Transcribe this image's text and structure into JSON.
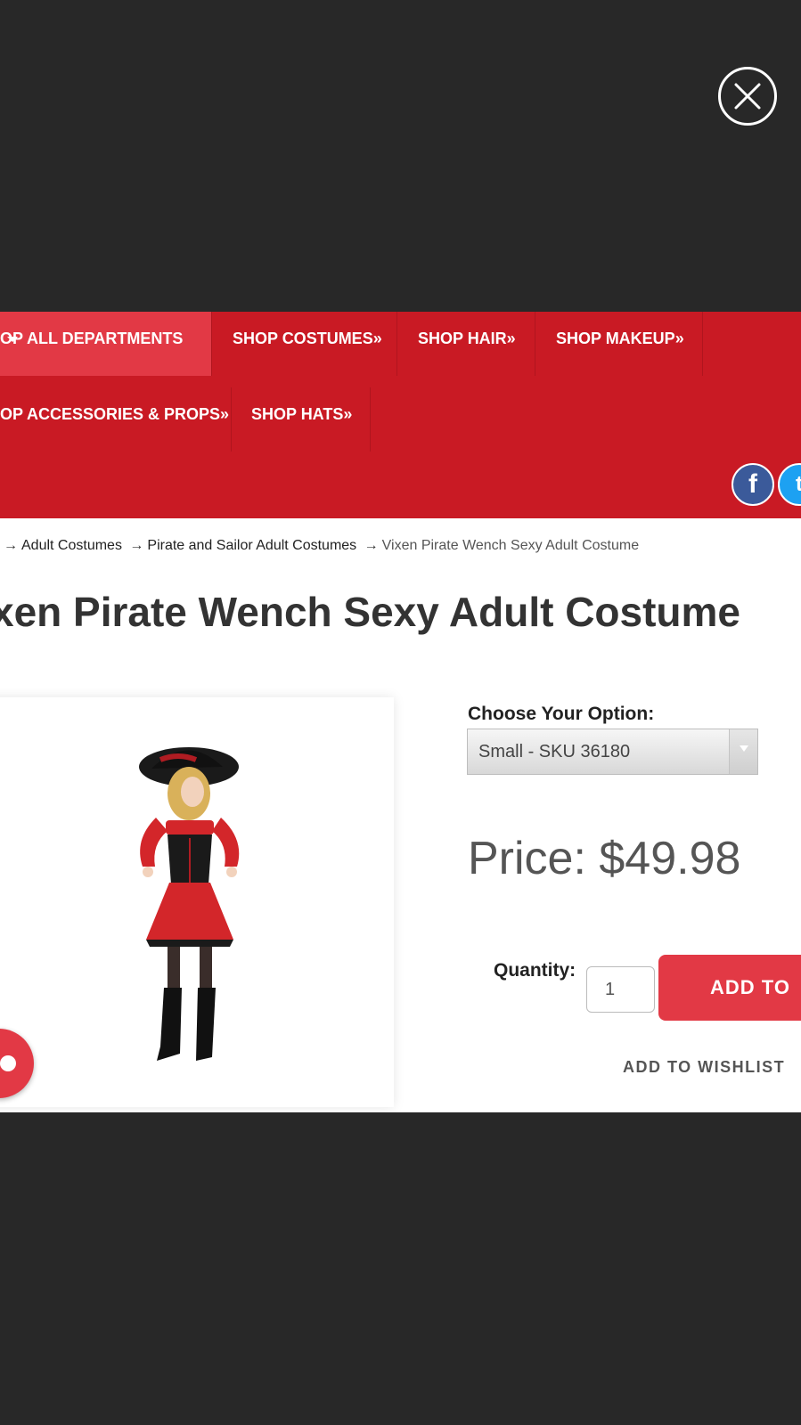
{
  "overlay": {
    "close_icon": "close-icon"
  },
  "nav": {
    "row1": [
      {
        "label": "OP ALL DEPARTMENTS",
        "active": true,
        "icon": "caret-down-icon"
      },
      {
        "label": "SHOP COSTUMES»"
      },
      {
        "label": "SHOP HAIR»"
      },
      {
        "label": "SHOP MAKEUP»"
      }
    ],
    "row2": [
      {
        "label": "OP ACCESSORIES & PROPS»"
      },
      {
        "label": "SHOP HATS»"
      }
    ],
    "social": {
      "facebook": "f",
      "twitter": "t"
    }
  },
  "breadcrumb": {
    "sep": "→",
    "items": [
      "Adult Costumes",
      "Pirate and Sailor Adult Costumes",
      "Vixen Pirate Wench Sexy Adult Costume"
    ]
  },
  "product": {
    "title": "xen Pirate Wench Sexy Adult Costume",
    "option_label": "Choose Your Option:",
    "option_selected": "Small - SKU 36180",
    "price": "Price: $49.98",
    "quantity_label": "Quantity:",
    "quantity_value": "1",
    "add_to_cart": "ADD TO",
    "add_to_wishlist": "ADD TO WISHLIST"
  },
  "colors": {
    "nav_red": "#c91a24",
    "accent_red": "#e23945",
    "backdrop": "#282828"
  }
}
